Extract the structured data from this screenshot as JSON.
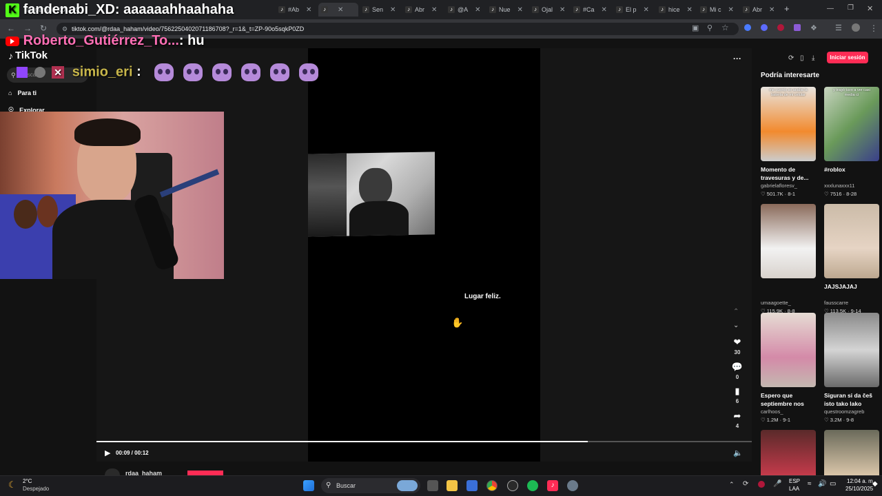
{
  "browser": {
    "tabs": [
      {
        "label": "fandenabi_XD",
        "icon": "kick-icon"
      },
      {
        "label": "#Ab",
        "icon": "tiktok-icon"
      },
      {
        "label": "",
        "icon": "tiktok-icon",
        "active": true
      },
      {
        "label": "Sen",
        "icon": "tiktok-icon"
      },
      {
        "label": "Abr",
        "icon": "tiktok-icon"
      },
      {
        "label": "@A",
        "icon": "tiktok-icon"
      },
      {
        "label": "Nue",
        "icon": "tiktok-icon"
      },
      {
        "label": "Ojal",
        "icon": "tiktok-icon"
      },
      {
        "label": "#Ca",
        "icon": "tiktok-icon"
      },
      {
        "label": "El p",
        "icon": "tiktok-icon"
      },
      {
        "label": "hice",
        "icon": "tiktok-icon"
      },
      {
        "label": "Mi c",
        "icon": "tiktok-icon"
      },
      {
        "label": "Abr",
        "icon": "tiktok-icon"
      }
    ],
    "new_tab": "+",
    "url": "tiktok.com/@rdaa_haham/video/7562250402071186708?_r=1&_t=ZP-90o5sqkP0ZD"
  },
  "tiktok": {
    "logo": "TikTok",
    "search_placeholder": "Buscar",
    "nav": [
      {
        "label": "Para ti",
        "icon": "home-icon"
      },
      {
        "label": "Explorar",
        "icon": "compass-icon"
      }
    ],
    "login_label": "Iniciar sesión",
    "more_label": "···",
    "video": {
      "caption": "Lugar feliz.",
      "time": "00:09 / 00:12",
      "progress": 0.75,
      "author": "rdaa_haham"
    },
    "actions": [
      {
        "name": "like",
        "icon": "heart-icon",
        "count": "30"
      },
      {
        "name": "comment",
        "icon": "comment-icon",
        "count": "0"
      },
      {
        "name": "bookmark",
        "icon": "bookmark-icon",
        "count": "6"
      },
      {
        "name": "share",
        "icon": "share-icon",
        "count": "4"
      }
    ],
    "sidebar_title": "Podría interesarte",
    "suggestions": [
      {
        "title": "Momento de travesuras y de...",
        "author": "gabrielafloresv_",
        "meta": "♡ 501.7K · 8-1",
        "overlay": "me cuento se acaba la batería de mi celular"
      },
      {
        "title": "#roblox",
        "author": "xxxlunaxxx11",
        "meta": "♡ 7516 · 8-28",
        "overlay": "y tragó tuvo a ver casi media ci"
      },
      {
        "title": "",
        "author": "umaagoette_",
        "meta": "♡ 115.9K · 8-8",
        "overlay": ""
      },
      {
        "title": "JAJSJAJAJ",
        "author": "fausscarre",
        "meta": "♡ 113.5K · 9-14",
        "overlay": ""
      },
      {
        "title": "Espero que septiembre nos trat...",
        "author": "carlhoos_",
        "meta": "♡ 1.2M · 9-1",
        "overlay": ""
      },
      {
        "title": "Siguran si da češ isto tako lako prevariti...",
        "author": "questroomzagreb",
        "meta": "♡ 3.2M · 9-8",
        "overlay": ""
      },
      {
        "title": "",
        "author": "",
        "meta": "",
        "overlay": ""
      },
      {
        "title": "",
        "author": "",
        "meta": "",
        "overlay": ""
      }
    ]
  },
  "overlay_chat": [
    {
      "user": "fandenabi_XD",
      "message": ": aaaaaahhaahaha",
      "platform": "kick-icon",
      "color": "#ffffff"
    },
    {
      "user": "Roberto_Gutiérrez_To...",
      "message": ": hu",
      "platform": "youtube-icon",
      "color": "#ff6fb5"
    },
    {
      "user": "simio_eri",
      "message": ":",
      "platform": "twitch-icon",
      "color": "#c8b64a"
    }
  ],
  "taskbar": {
    "weather_temp": "2°C",
    "weather_desc": "Despejado",
    "search_label": "Buscar",
    "lang": "ESP",
    "lang2": "LAA",
    "time": "12:04 a. m.",
    "date": "25/10/2025"
  },
  "colors": {
    "accent": "#fe2c55",
    "kick": "#53fc18"
  }
}
